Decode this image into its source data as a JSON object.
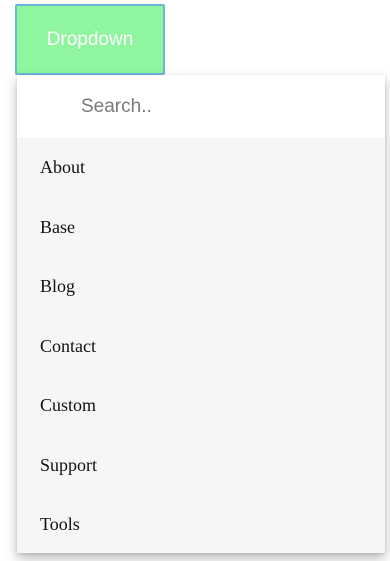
{
  "dropdown": {
    "button_label": "Dropdown",
    "search_placeholder": "Search..",
    "items": [
      {
        "label": "About"
      },
      {
        "label": "Base"
      },
      {
        "label": "Blog"
      },
      {
        "label": "Contact"
      },
      {
        "label": "Custom"
      },
      {
        "label": "Support"
      },
      {
        "label": "Tools"
      }
    ]
  },
  "colors": {
    "button_bg": "#8ff59f",
    "button_border": "#6ab7d8",
    "panel_bg": "#f6f6f6",
    "search_bg": "#ffffff"
  }
}
